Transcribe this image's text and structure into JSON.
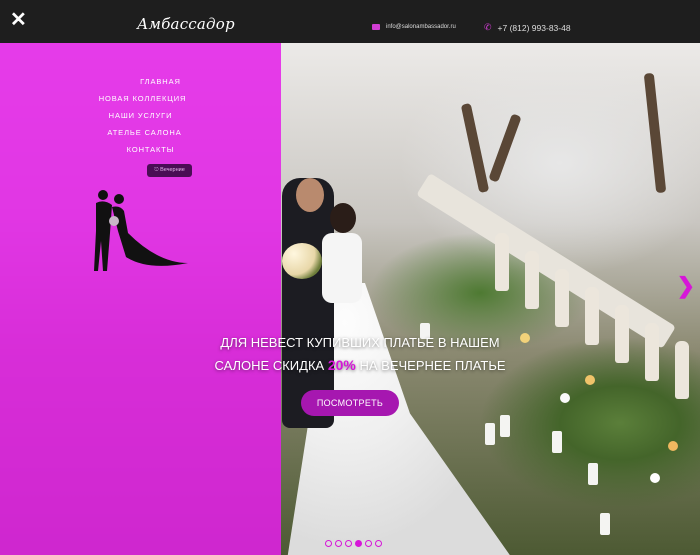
{
  "header": {
    "close_label": "✕",
    "logo_text": "Амбассадор",
    "email": "info@salonambassador.ru",
    "phone": "+7 (812) 993-83-48"
  },
  "menu": {
    "items": [
      {
        "label": "Главная"
      },
      {
        "label": "Новая коллекция"
      },
      {
        "label": "Наши услуги"
      },
      {
        "label": "Ателье салона"
      },
      {
        "label": "Контакты"
      }
    ],
    "pill_label": "⎋ Вечерние"
  },
  "hero": {
    "headline_line1": "Для невест купивших платье в нашем",
    "headline_line2_prefix": "салоне скидка",
    "headline_accent": "20%",
    "headline_line2_suffix": "на вечернее платье",
    "cta_label": "ПОСМОТРЕТЬ"
  },
  "carousel": {
    "next_icon": "chevron-right-icon",
    "slide_count": 6,
    "active_slide": 4
  },
  "colors": {
    "accent": "#d616d8",
    "overlay": "#e41ee9",
    "cta": "#a617b0",
    "topbar": "#1e1e1e"
  }
}
